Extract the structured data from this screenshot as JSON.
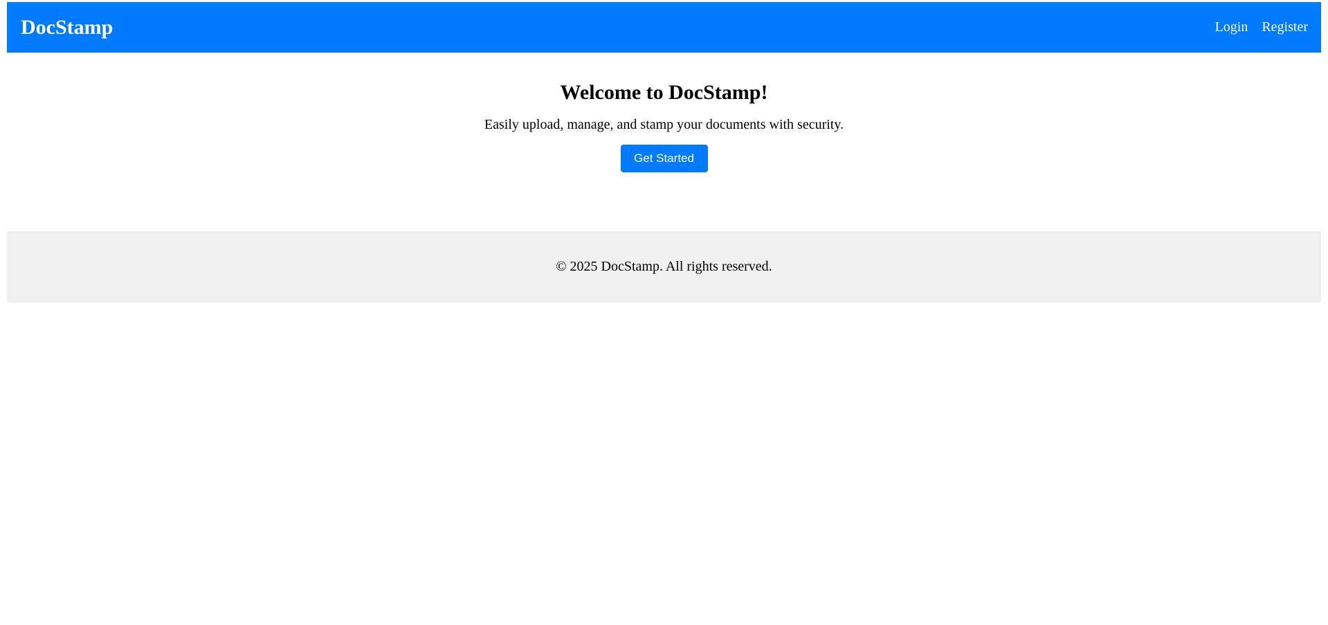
{
  "header": {
    "brand": "DocStamp",
    "nav": {
      "login": "Login",
      "register": "Register"
    }
  },
  "hero": {
    "title": "Welcome to DocStamp!",
    "subtitle": "Easily upload, manage, and stamp your documents with security.",
    "cta_label": "Get Started"
  },
  "footer": {
    "copyright": "© 2025 DocStamp. All rights reserved."
  },
  "colors": {
    "primary": "#007bff",
    "footer_bg": "#f0f0f0",
    "text": "#000000",
    "on_primary": "#ffffff"
  }
}
